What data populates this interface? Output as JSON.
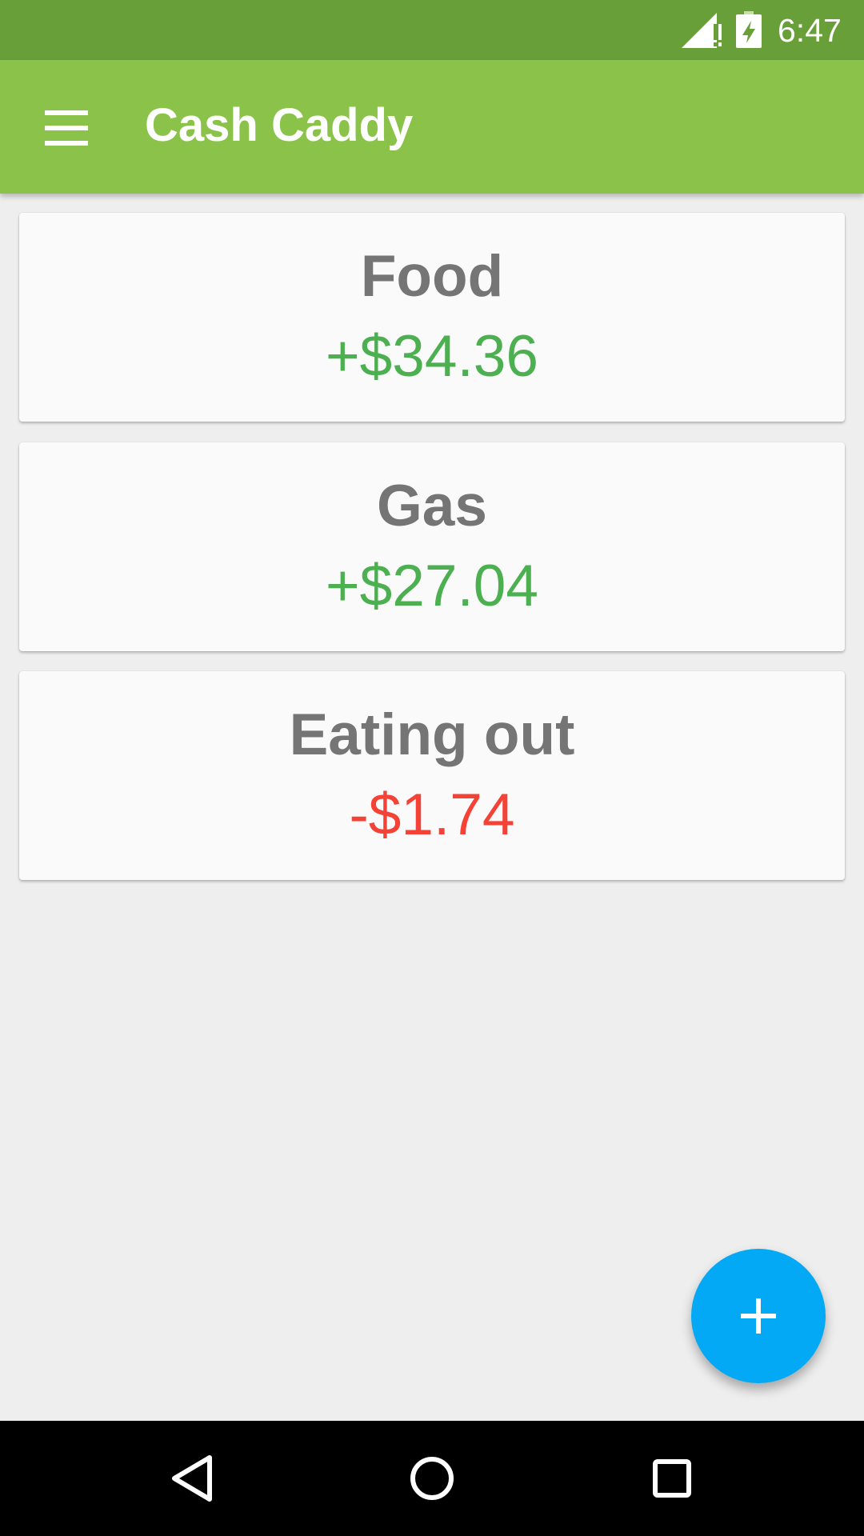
{
  "status_bar": {
    "time": "6:47",
    "icons": [
      "signal-icon",
      "battery-charging-icon"
    ]
  },
  "app_bar": {
    "title": "Cash Caddy",
    "menu_icon": "hamburger-menu-icon"
  },
  "categories": [
    {
      "name": "Food",
      "amount": "+$34.36",
      "status": "positive"
    },
    {
      "name": "Gas",
      "amount": "+$27.04",
      "status": "positive"
    },
    {
      "name": "Eating out",
      "amount": "-$1.74",
      "status": "negative"
    }
  ],
  "fab": {
    "icon": "plus-icon"
  },
  "nav_bar": {
    "icons": [
      "back-icon",
      "home-icon",
      "recents-icon"
    ]
  },
  "colors": {
    "status_bar": "#689f38",
    "app_bar": "#8bc34a",
    "positive": "#4caf50",
    "negative": "#f44336",
    "fab": "#03a9f4",
    "card_title": "#757575"
  }
}
